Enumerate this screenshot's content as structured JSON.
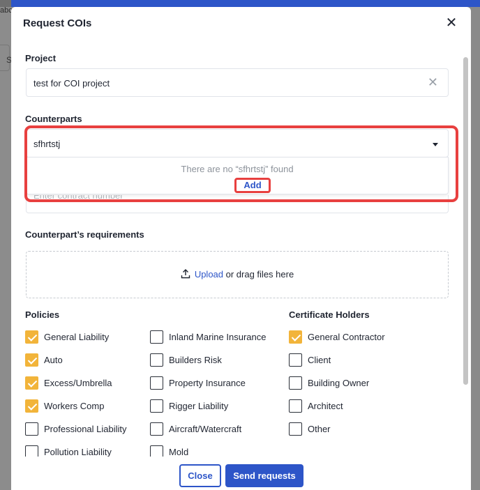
{
  "background": {
    "left_text": "abc",
    "left_letter": "S"
  },
  "modal": {
    "title": "Request COIs",
    "close_glyph": "✕"
  },
  "project": {
    "label": "Project",
    "value": "test for COI project",
    "clear_glyph": "✕"
  },
  "counterparts": {
    "label": "Counterparts",
    "value": "sfhrtstj",
    "dropdown_empty": "There are no “sfhrtstj” found",
    "add_label": "Add"
  },
  "contract": {
    "placeholder": "Enter contract number"
  },
  "requirements": {
    "label": "Counterpart’s requirements",
    "upload_link": "Upload",
    "upload_rest": " or drag files here"
  },
  "policies": {
    "label": "Policies",
    "col1": [
      {
        "label": "General Liability",
        "checked": true
      },
      {
        "label": "Auto",
        "checked": true
      },
      {
        "label": "Excess/Umbrella",
        "checked": true
      },
      {
        "label": "Workers Comp",
        "checked": true
      },
      {
        "label": "Professional Liability",
        "checked": false
      },
      {
        "label": "Pollution Liability",
        "checked": false
      }
    ],
    "col2": [
      {
        "label": "Inland Marine Insurance",
        "checked": false
      },
      {
        "label": "Builders Risk",
        "checked": false
      },
      {
        "label": "Property Insurance",
        "checked": false
      },
      {
        "label": "Rigger Liability",
        "checked": false
      },
      {
        "label": "Aircraft/Watercraft",
        "checked": false
      },
      {
        "label": "Mold",
        "checked": false
      }
    ]
  },
  "certificate_holders": {
    "label": "Certificate Holders",
    "items": [
      {
        "label": "General Contractor",
        "checked": true
      },
      {
        "label": "Client",
        "checked": false
      },
      {
        "label": "Building Owner",
        "checked": false
      },
      {
        "label": "Architect",
        "checked": false
      },
      {
        "label": "Other",
        "checked": false
      }
    ]
  },
  "footer": {
    "close_label": "Close",
    "send_label": "Send requests"
  },
  "colors": {
    "accent": "#2d55c8",
    "checkbox_checked": "#f2b43a",
    "highlight": "#e8403f"
  }
}
